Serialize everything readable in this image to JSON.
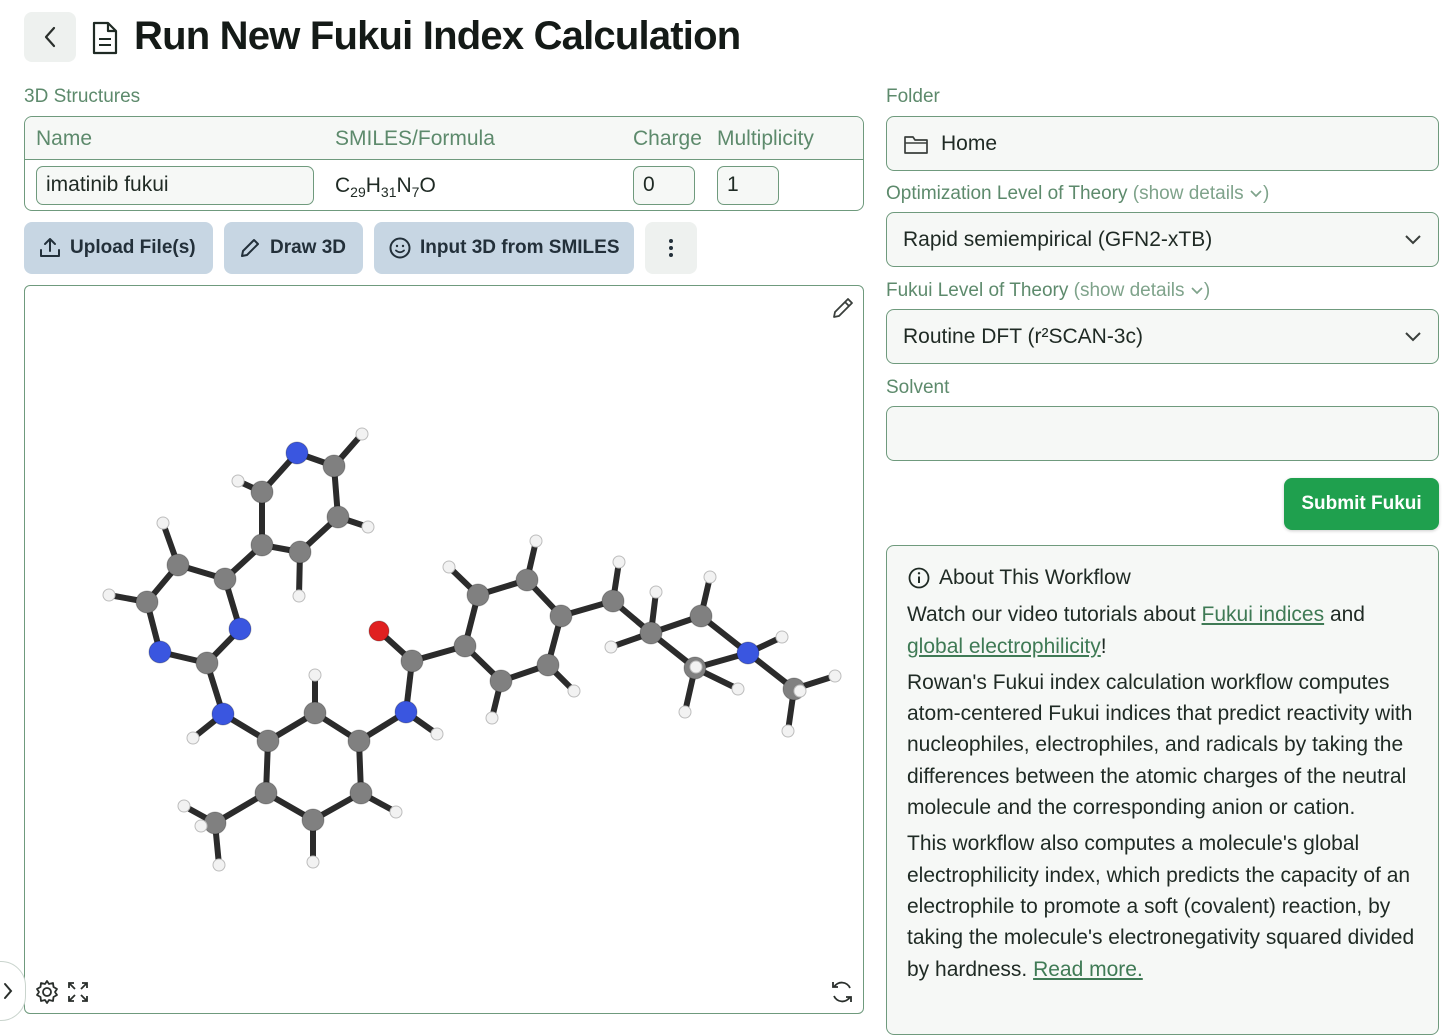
{
  "header": {
    "title": "Run New Fukui Index Calculation"
  },
  "structures": {
    "section_label": "3D Structures",
    "columns": [
      "Name",
      "SMILES/Formula",
      "Charge",
      "Multiplicity"
    ],
    "row": {
      "name": "imatinib fukui",
      "formula": {
        "c": "C",
        "c_n": "29",
        "h": "H",
        "h_n": "31",
        "n": "N",
        "n_n": "7",
        "o": "O"
      },
      "charge": "0",
      "multiplicity": "1"
    }
  },
  "actions": {
    "upload_label": "Upload File(s)",
    "draw_label": "Draw 3D",
    "smiles_label": "Input 3D from SMILES"
  },
  "form": {
    "folder_label": "Folder",
    "folder_value": "Home",
    "opt_label": "Optimization Level of Theory",
    "show_details": "(show details",
    "opt_value": "Rapid semiempirical (GFN2-xTB)",
    "fukui_label": "Fukui Level of Theory",
    "fukui_value": "Routine DFT (r²SCAN-3c)",
    "solvent_label": "Solvent",
    "solvent_value": "",
    "submit_label": "Submit Fukui"
  },
  "about": {
    "title": "About This Workflow",
    "p1_start": "Watch our video tutorials about ",
    "p1_link1": "Fukui indices",
    "p1_mid": " and ",
    "p1_link2": "global electrophilicity",
    "p1_end": "!",
    "p2": "Rowan's Fukui index calculation workflow computes atom-centered Fukui indices that predict reactivity with nucleophiles, electrophiles, and radicals by taking the differences between the atomic charges of the neutral molecule and the corresponding anion or cation.",
    "p3_text": "This workflow also computes a molecule's global electrophilicity index, which predicts the capacity of an electrophile to promote a soft (covalent) reaction, by taking the molecule's electronegativity squared divided by hardness. ",
    "p3_link": "Read more."
  },
  "colors": {
    "accent_green": "#1fa04e",
    "border_green": "#6f9a7d",
    "label_green": "#5d8a6c",
    "action_blue": "#c7d6e3",
    "atom_carbon": "#808080",
    "atom_nitrogen": "#3a56e0",
    "atom_oxygen": "#e02020",
    "atom_hydrogen": "#f2f2f2"
  }
}
